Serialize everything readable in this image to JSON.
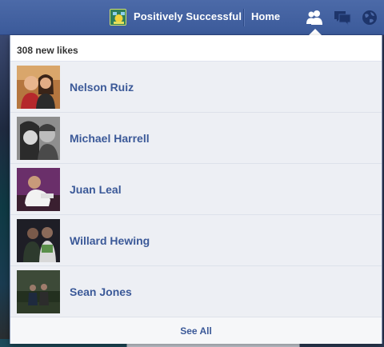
{
  "topbar": {
    "page_name": "Positively Successful",
    "home_label": "Home",
    "icons": [
      "friend-requests-icon",
      "messages-icon",
      "notifications-globe-icon"
    ]
  },
  "flyout": {
    "title": "308 new likes",
    "see_all": "See All",
    "items": [
      {
        "name": "Nelson Ruiz"
      },
      {
        "name": "Michael Harrell"
      },
      {
        "name": "Juan Leal"
      },
      {
        "name": "Willard Hewing"
      },
      {
        "name": "Sean Jones"
      }
    ]
  },
  "colors": {
    "bar_blue": "#3b5998",
    "link_blue": "#3b5998",
    "row_bg": "#edeff4"
  }
}
